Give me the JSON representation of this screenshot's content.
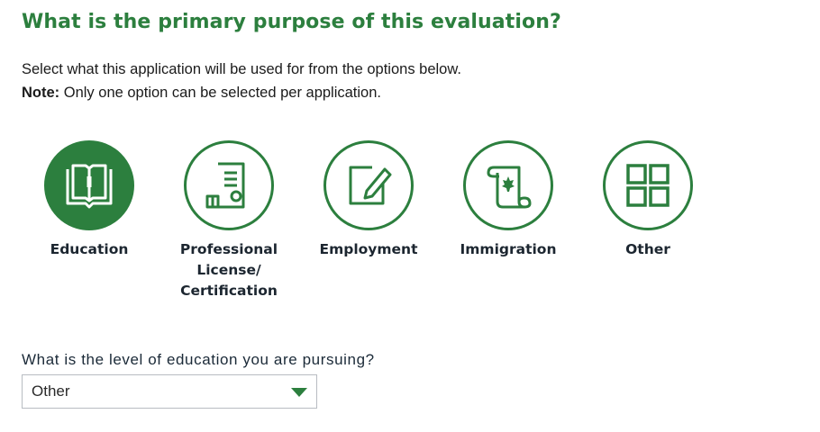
{
  "page": {
    "title": "What is the primary purpose of this evaluation?",
    "intro_line": "Select what this application will be used for from the options below.",
    "note_label": "Note:",
    "note_text": " Only one option can be selected per application.",
    "accent_color": "#2c7f3e"
  },
  "options": [
    {
      "label": "Education",
      "icon": "open-book-icon",
      "selected": true
    },
    {
      "label": "Professional License/ Certification",
      "icon": "certificate-document-icon",
      "selected": false
    },
    {
      "label": "Employment",
      "icon": "edit-pencil-icon",
      "selected": false
    },
    {
      "label": "Immigration",
      "icon": "scroll-maple-leaf-icon",
      "selected": false
    },
    {
      "label": "Other",
      "icon": "grid-four-squares-icon",
      "selected": false
    }
  ],
  "education_level": {
    "question": "What is the level of education you are pursuing?",
    "selected_value": "Other"
  }
}
